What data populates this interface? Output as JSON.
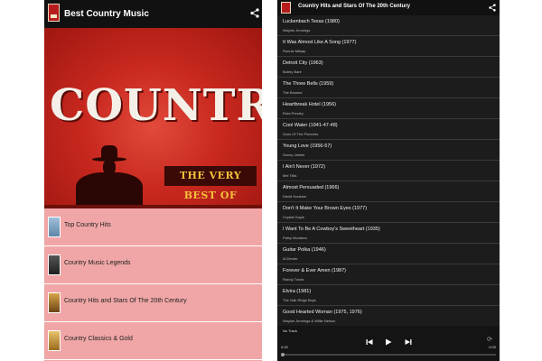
{
  "left_app": {
    "title": "Best Country Music",
    "banner_word": "COUNTRY",
    "banner_sub": "THE VERY BEST OF",
    "menu": [
      {
        "label": "Top Country Hits",
        "thumb_color": "#7fa6c9"
      },
      {
        "label": "Country Music Legends",
        "thumb_color": "#333333"
      },
      {
        "label": "Country Hits and Stars Of The 20th Century",
        "thumb_color": "#a5782e"
      },
      {
        "label": "Country Classics & Gold",
        "thumb_color": "#c99a3c"
      }
    ]
  },
  "right_app": {
    "title": "Country Hits and Stars Of The 20th Century",
    "songs": [
      {
        "title": "Luckenbach Texas (1980)",
        "artist": "Waylon Jennings"
      },
      {
        "title": "It Was Almost Like A Song (1977)",
        "artist": "Ronnie Milsap"
      },
      {
        "title": "Detroit City (1963)",
        "artist": "Bobby Bare"
      },
      {
        "title": "The Three Bells (1959)",
        "artist": "The Browns"
      },
      {
        "title": "Heartbreak Hotel (1956)",
        "artist": "Elvis Presley"
      },
      {
        "title": "Cool Water (1941-47-48)",
        "artist": "Sons Of The Pioneers"
      },
      {
        "title": "Young Love (1956-57)",
        "artist": "Sonny James"
      },
      {
        "title": "I Ain't Never (1972)",
        "artist": "Mel Tillis"
      },
      {
        "title": "Almost Persuaded (1966)",
        "artist": "David Houston"
      },
      {
        "title": "Don't It Make Your Brown Eyes (1977)",
        "artist": "Crystal Gayle"
      },
      {
        "title": "I Want To Be A Cowboy's Sweetheart (1935)",
        "artist": "Patsy Montana"
      },
      {
        "title": "Guitar Polka (1946)",
        "artist": "Al Dexter"
      },
      {
        "title": "Forever & Ever Amen (1987)",
        "artist": "Randy Travis"
      },
      {
        "title": "Elvira (1981)",
        "artist": "The Oak Ridge Boys"
      },
      {
        "title": "Good Hearted Woman (1975, 1976)",
        "artist": "Waylon Jennings & Willie Nelson"
      }
    ],
    "player": {
      "track": "No Track",
      "time_elapsed": "0:00",
      "time_total": "0:00",
      "progress": 0
    }
  },
  "icons": {
    "share": "share-icon",
    "prev": "previous-icon",
    "play": "play-icon",
    "next": "next-icon",
    "repeat": "repeat-icon"
  }
}
